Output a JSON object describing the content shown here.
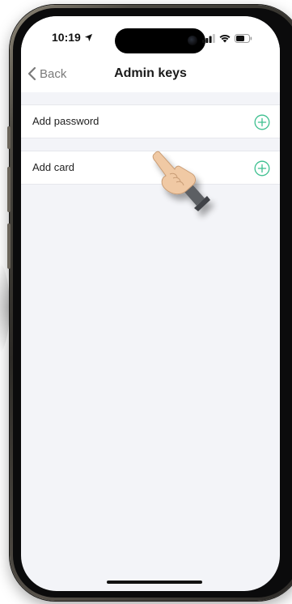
{
  "status_bar": {
    "time": "10:19",
    "location_icon": "location-arrow-icon",
    "signal_icon": "cellular-signal-icon",
    "wifi_icon": "wifi-icon",
    "battery_icon": "battery-icon"
  },
  "nav": {
    "back_label": "Back",
    "title": "Admin keys"
  },
  "items": [
    {
      "label": "Add password",
      "action_icon": "add-circle-icon"
    },
    {
      "label": "Add card",
      "action_icon": "add-circle-icon"
    }
  ],
  "colors": {
    "accent": "#3cbf8f",
    "background": "#f3f4f8",
    "surface": "#ffffff",
    "text": "#222222",
    "back_text": "#7a7a7a"
  }
}
